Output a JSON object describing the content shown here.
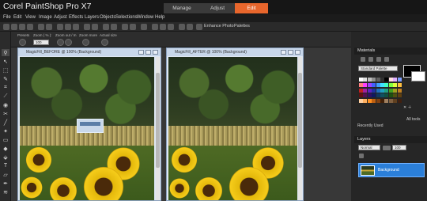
{
  "app": {
    "title": "Corel PaintShop Pro X7"
  },
  "workspace_tabs": [
    {
      "label": "Manage",
      "active": false
    },
    {
      "label": "Adjust",
      "active": false
    },
    {
      "label": "Edit",
      "active": true
    }
  ],
  "menu": [
    "File",
    "Edit",
    "View",
    "Image",
    "Adjust",
    "Effects",
    "Layers",
    "Objects",
    "Selections",
    "Window",
    "Help"
  ],
  "toolbar": {
    "enhance_photo_label": "Enhance Photo",
    "palettes_label": "Palettes"
  },
  "tool_options": {
    "labels": [
      "Presets",
      "Zoom ( % ):",
      "Zoom out / In",
      "Zoom more",
      "Actual size"
    ],
    "zoom_value": "100"
  },
  "documents": [
    {
      "title": "MagicFill_BEFORE @ 100% (Background)"
    },
    {
      "title": "MagicFill_AFTER @ 100% (Background)"
    }
  ],
  "materials_panel": {
    "title": "Materials",
    "palette_select": "Standard Palette",
    "recently_used": "Recently Used",
    "all_tools": "All tools"
  },
  "layers_panel": {
    "title": "Layers",
    "blend_mode": "Normal",
    "opacity": "100",
    "layer_name": "Background"
  },
  "colors": {
    "accent": "#e8662c",
    "selected_layer": "#2b7fd9"
  }
}
